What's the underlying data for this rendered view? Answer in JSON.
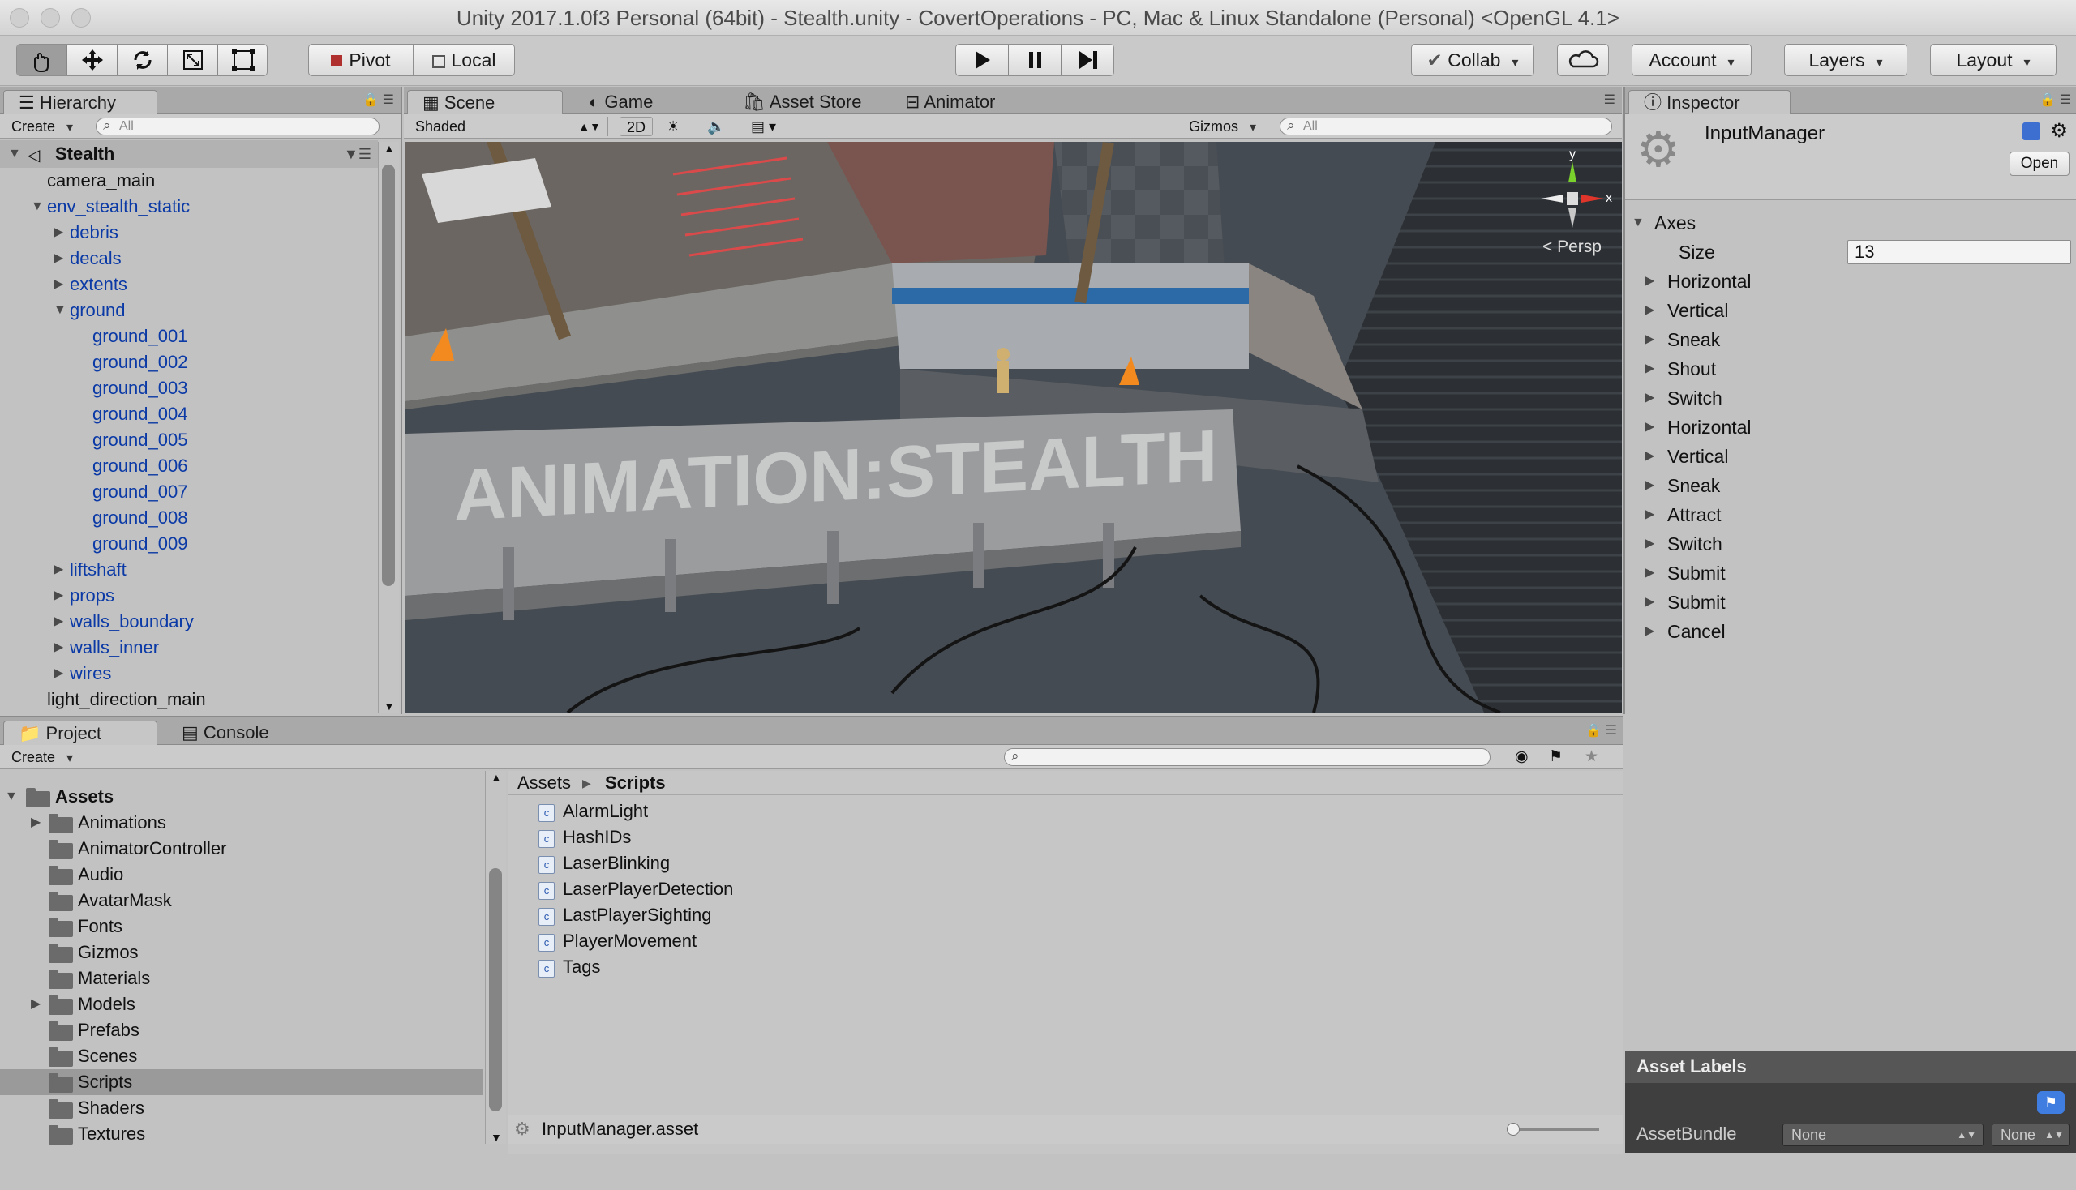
{
  "window": {
    "title": "Unity 2017.1.0f3 Personal (64bit) - Stealth.unity - CovertOperations - PC, Mac & Linux Standalone (Personal) <OpenGL 4.1>"
  },
  "toolbar": {
    "pivot": "Pivot",
    "local": "Local",
    "collab": "Collab",
    "account": "Account",
    "layers": "Layers",
    "layout": "Layout"
  },
  "hierarchy": {
    "tab": "Hierarchy",
    "create": "Create",
    "search_placeholder": "All",
    "scene": "Stealth",
    "items": [
      {
        "label": "camera_main",
        "depth": 0,
        "arrow": "",
        "blue": false
      },
      {
        "label": "env_stealth_static",
        "depth": 0,
        "arrow": "down",
        "blue": true
      },
      {
        "label": "debris",
        "depth": 1,
        "arrow": "right",
        "blue": true
      },
      {
        "label": "decals",
        "depth": 1,
        "arrow": "right",
        "blue": true
      },
      {
        "label": "extents",
        "depth": 1,
        "arrow": "right",
        "blue": true
      },
      {
        "label": "ground",
        "depth": 1,
        "arrow": "down",
        "blue": true
      },
      {
        "label": "ground_001",
        "depth": 2,
        "arrow": "",
        "blue": true
      },
      {
        "label": "ground_002",
        "depth": 2,
        "arrow": "",
        "blue": true
      },
      {
        "label": "ground_003",
        "depth": 2,
        "arrow": "",
        "blue": true
      },
      {
        "label": "ground_004",
        "depth": 2,
        "arrow": "",
        "blue": true
      },
      {
        "label": "ground_005",
        "depth": 2,
        "arrow": "",
        "blue": true
      },
      {
        "label": "ground_006",
        "depth": 2,
        "arrow": "",
        "blue": true
      },
      {
        "label": "ground_007",
        "depth": 2,
        "arrow": "",
        "blue": true
      },
      {
        "label": "ground_008",
        "depth": 2,
        "arrow": "",
        "blue": true
      },
      {
        "label": "ground_009",
        "depth": 2,
        "arrow": "",
        "blue": true
      },
      {
        "label": "liftshaft",
        "depth": 1,
        "arrow": "right",
        "blue": true
      },
      {
        "label": "props",
        "depth": 1,
        "arrow": "right",
        "blue": true
      },
      {
        "label": "walls_boundary",
        "depth": 1,
        "arrow": "right",
        "blue": true
      },
      {
        "label": "walls_inner",
        "depth": 1,
        "arrow": "right",
        "blue": true
      },
      {
        "label": "wires",
        "depth": 1,
        "arrow": "right",
        "blue": true
      },
      {
        "label": "light_direction_main",
        "depth": 0,
        "arrow": "",
        "blue": false
      }
    ]
  },
  "scene": {
    "tabs": [
      "Scene",
      "Game",
      "Asset Store",
      "Animator"
    ],
    "shading": "Shaded",
    "mode2d": "2D",
    "gizmos": "Gizmos",
    "search_placeholder": "All",
    "persp": "Persp",
    "axis_y": "y",
    "axis_x": "x",
    "wall_text": "ANIMATION:STEALTH"
  },
  "project": {
    "tabs": [
      "Project",
      "Console"
    ],
    "create": "Create",
    "root": "Assets",
    "folders": [
      {
        "label": "Animations",
        "arrow": true,
        "selected": false
      },
      {
        "label": "AnimatorController",
        "arrow": false,
        "selected": false
      },
      {
        "label": "Audio",
        "arrow": false,
        "selected": false
      },
      {
        "label": "AvatarMask",
        "arrow": false,
        "selected": false
      },
      {
        "label": "Fonts",
        "arrow": false,
        "selected": false
      },
      {
        "label": "Gizmos",
        "arrow": false,
        "selected": false
      },
      {
        "label": "Materials",
        "arrow": false,
        "selected": false
      },
      {
        "label": "Models",
        "arrow": true,
        "selected": false
      },
      {
        "label": "Prefabs",
        "arrow": false,
        "selected": false
      },
      {
        "label": "Scenes",
        "arrow": false,
        "selected": false
      },
      {
        "label": "Scripts",
        "arrow": false,
        "selected": true
      },
      {
        "label": "Shaders",
        "arrow": false,
        "selected": false
      },
      {
        "label": "Textures",
        "arrow": false,
        "selected": false
      }
    ],
    "breadcrumb": [
      "Assets",
      "Scripts"
    ],
    "files": [
      "AlarmLight",
      "HashIDs",
      "LaserBlinking",
      "LaserPlayerDetection",
      "LastPlayerSighting",
      "PlayerMovement",
      "Tags"
    ],
    "status_file": "InputManager.asset"
  },
  "inspector": {
    "tab": "Inspector",
    "title": "InputManager",
    "open": "Open",
    "section": "Axes",
    "size_label": "Size",
    "size_value": "13",
    "axes": [
      "Horizontal",
      "Vertical",
      "Sneak",
      "Shout",
      "Switch",
      "Horizontal",
      "Vertical",
      "Sneak",
      "Attract",
      "Switch",
      "Submit",
      "Submit",
      "Cancel"
    ],
    "asset_labels": "Asset Labels",
    "assetbundle_label": "AssetBundle",
    "bundle_value": "None",
    "variant_value": "None"
  }
}
